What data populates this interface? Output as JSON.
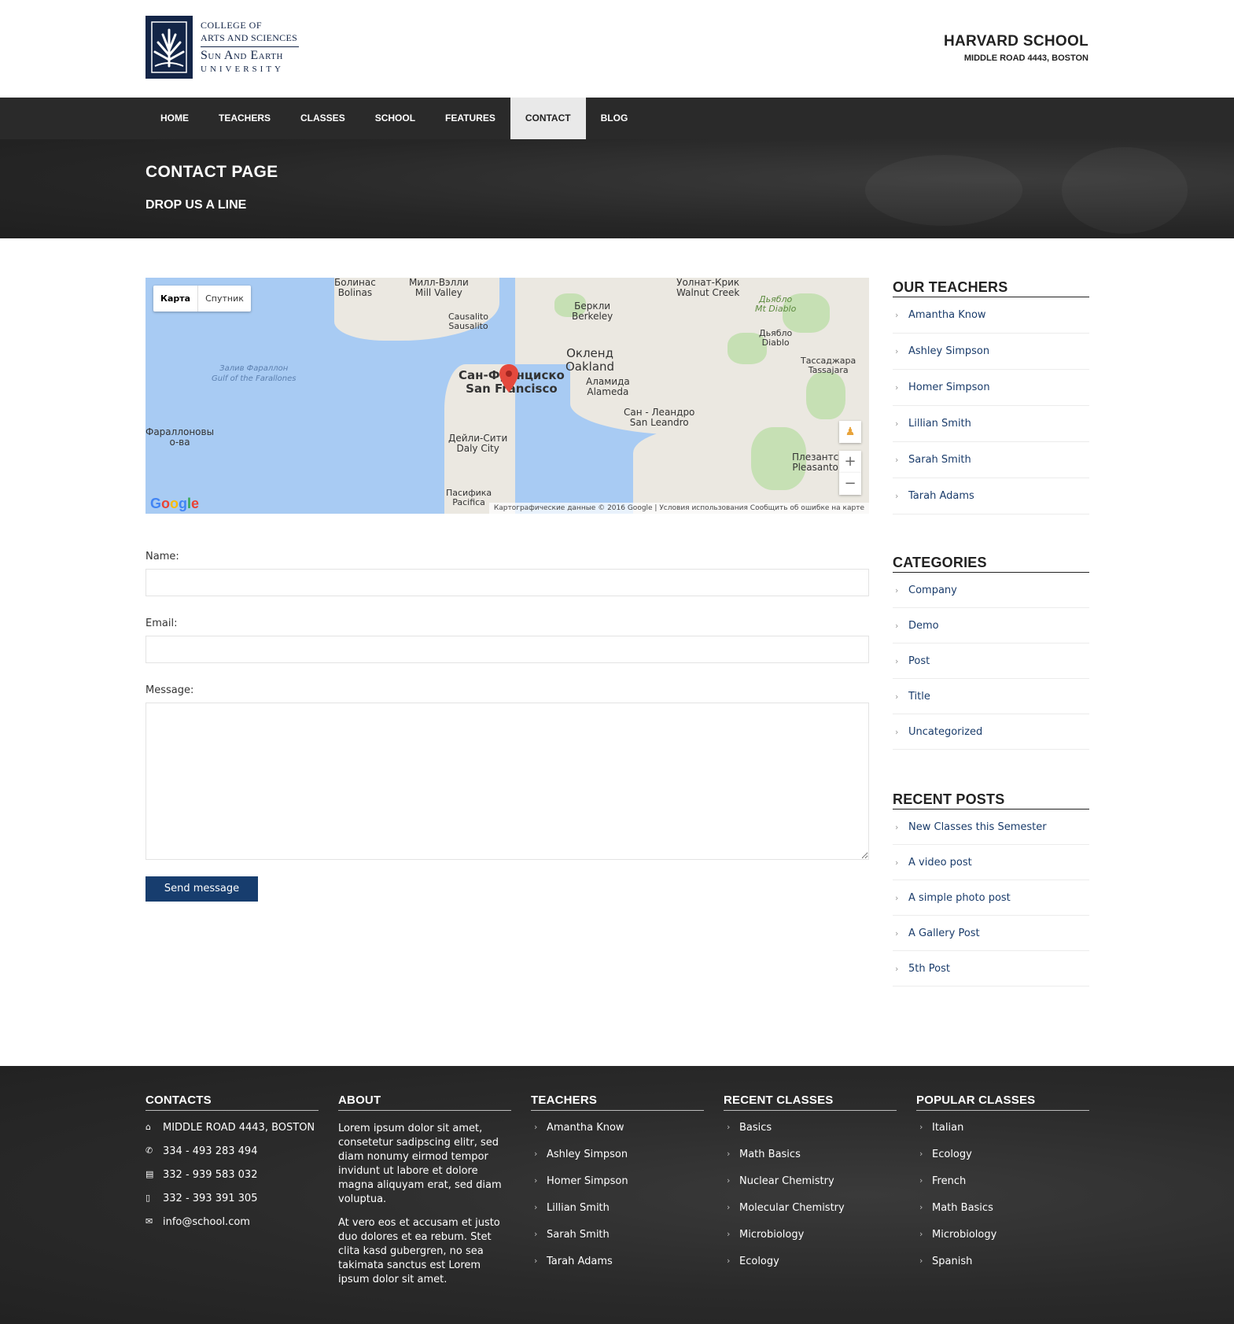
{
  "logo": {
    "line1": "COLLEGE OF",
    "line2": "ARTS AND SCIENCES",
    "line3": "Sun And Earth",
    "line4": "UNIVERSITY"
  },
  "school": {
    "name": "HARVARD SCHOOL",
    "address": "MIDDLE ROAD 4443, BOSTON"
  },
  "nav": {
    "items": [
      {
        "label": "HOME"
      },
      {
        "label": "TEACHERS"
      },
      {
        "label": "CLASSES"
      },
      {
        "label": "SCHOOL"
      },
      {
        "label": "FEATURES"
      },
      {
        "label": "CONTACT",
        "active": true
      },
      {
        "label": "BLOG"
      }
    ]
  },
  "banner": {
    "title": "CONTACT PAGE",
    "subtitle": "DROP US A LINE"
  },
  "map": {
    "toggle_map": "Карта",
    "toggle_satellite": "Спутник",
    "labels": {
      "sf_ru": "Сан-Франциско",
      "sf_en": "San Francisco",
      "oakland_ru": "Окленд",
      "oakland_en": "Oakland",
      "berkeley_ru": "Беркли",
      "berkeley_en": "Berkeley",
      "alameda_ru": "Аламида",
      "alameda_en": "Alameda",
      "daly_ru": "Дейли-Сити",
      "daly_en": "Daly City",
      "sanleandro_ru": "Сан - Леандро",
      "sanleandro_en": "San Leandro",
      "sausalito_ru": "Сausalito",
      "sausalito_en": "Sausalito",
      "millvalley_ru": "Милл-Вэлли",
      "millvalley_en": "Mill Valley",
      "bolinas_ru": "Болинас",
      "bolinas_en": "Bolinas",
      "walnut_ru": "Уолнат-Крик",
      "walnut_en": "Walnut Creek",
      "diablo_ru": "Дьябло",
      "diablo_en": "Diablo",
      "mtdiablo_ru": "Дьябло",
      "mtdiablo_en": "Mt Diablo",
      "tassajara_ru": "Тассаджара",
      "tassajara_en": "Tassajara",
      "pleasanton_ru": "Плезантс",
      "pleasanton_en": "Pleasanto",
      "pacifica_ru": "Пасифика",
      "pacifica_en": "Pacifica",
      "farallon_ru": "Фараллоновы",
      "farallon_en": "о-ва",
      "gulf_ru": "Залив Фараллон",
      "gulf_en": "Gulf of the Farallones"
    },
    "brand": "Google",
    "footer": "Картографические данные © 2016 Google  |  Условия использования   Сообщить об ошибке на карте"
  },
  "form": {
    "name_label": "Name:",
    "email_label": "Email:",
    "message_label": "Message:",
    "name_value": "",
    "email_value": "",
    "submit": "Send message"
  },
  "sidebar": {
    "teachers": {
      "title": "OUR TEACHERS",
      "items": [
        "Amantha Know",
        "Ashley Simpson",
        "Homer Simpson",
        "Lillian Smith",
        "Sarah Smith",
        "Tarah Adams"
      ]
    },
    "categories": {
      "title": "CATEGORIES",
      "items": [
        "Company",
        "Demo",
        "Post",
        "Title",
        "Uncategorized"
      ]
    },
    "recent_posts": {
      "title": "RECENT POSTS",
      "items": [
        "New Classes this Semester",
        "A video post",
        "A simple photo post",
        "A Gallery Post",
        "5th Post"
      ]
    }
  },
  "footer": {
    "contacts": {
      "title": "CONTACTS",
      "items": [
        {
          "icon": "home-icon",
          "text": "MIDDLE ROAD 4443, BOSTON"
        },
        {
          "icon": "phone-icon",
          "text": "334 - 493 283 494"
        },
        {
          "icon": "fax-icon",
          "text": "332 - 939 583 032"
        },
        {
          "icon": "mobile-icon",
          "text": "332 - 393 391 305"
        },
        {
          "icon": "envelope-icon",
          "text": "info@school.com"
        }
      ]
    },
    "about": {
      "title": "ABOUT",
      "p1": "Lorem ipsum dolor sit amet, consetetur sadipscing elitr, sed diam nonumy eirmod tempor invidunt ut labore et dolore magna aliquyam erat, sed diam voluptua.",
      "p2": "At vero eos et accusam et justo duo dolores et ea rebum. Stet clita kasd gubergren, no sea takimata sanctus est Lorem ipsum dolor sit amet."
    },
    "teachers": {
      "title": "TEACHERS",
      "items": [
        "Amantha Know",
        "Ashley Simpson",
        "Homer Simpson",
        "Lillian Smith",
        "Sarah Smith",
        "Tarah Adams"
      ]
    },
    "recent_classes": {
      "title": "RECENT CLASSES",
      "items": [
        "Basics",
        "Math Basics",
        "Nuclear Chemistry",
        "Molecular Chemistry",
        "Microbiology",
        "Ecology"
      ]
    },
    "popular_classes": {
      "title": "POPULAR CLASSES",
      "items": [
        "Italian",
        "Ecology",
        "French",
        "Math Basics",
        "Microbiology",
        "Spanish"
      ]
    }
  },
  "colors": {
    "brand_navy": "#132547",
    "button_blue": "#173d6e",
    "link_blue": "#1a3c6b",
    "nav_bg": "#2a2a2a",
    "nav_active_bg": "#e9e9e9"
  }
}
